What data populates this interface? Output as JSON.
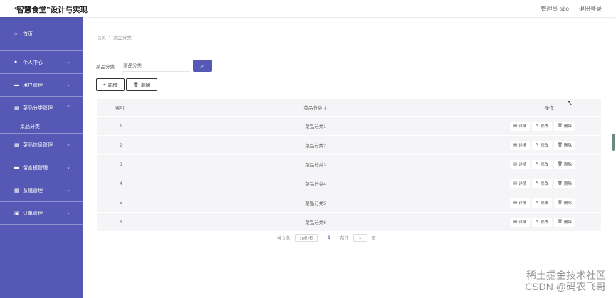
{
  "header": {
    "app_title": "“智慧食堂”设计与实现",
    "user_label": "管理员 abo",
    "logout_label": "退出登录"
  },
  "sidebar": {
    "items": [
      {
        "label": "首页",
        "icon": "home-icon",
        "glyph": "⌂"
      },
      {
        "label": "个人中心",
        "icon": "user-icon",
        "glyph": "●"
      },
      {
        "label": "用户管理",
        "icon": "folder-icon",
        "glyph": "▬"
      },
      {
        "label": "菜品分类管理",
        "icon": "grid-icon",
        "glyph": "▦"
      },
      {
        "label": "菜品信息管理",
        "icon": "grid-icon",
        "glyph": "▦"
      },
      {
        "label": "留言板管理",
        "icon": "card-icon",
        "glyph": "▬"
      },
      {
        "label": "系统管理",
        "icon": "grid-icon",
        "glyph": "▦"
      },
      {
        "label": "订单管理",
        "icon": "lock-icon",
        "glyph": "▣"
      }
    ],
    "sub_item": "菜品分类"
  },
  "breadcrumb": [
    "首页",
    "/",
    "菜品分类"
  ],
  "search": {
    "label": "菜品分类",
    "placeholder": "菜品分类",
    "button_icon": "search-icon"
  },
  "toolbar": {
    "add_label": "新增",
    "delete_label": "删除"
  },
  "table": {
    "headers": [
      "索引",
      "菜品分类 ⇕",
      "操作"
    ],
    "rows": [
      {
        "index": "1",
        "category": "菜品分类1"
      },
      {
        "index": "2",
        "category": "菜品分类2"
      },
      {
        "index": "3",
        "category": "菜品分类3"
      },
      {
        "index": "4",
        "category": "菜品分类4"
      },
      {
        "index": "5",
        "category": "菜品分类5"
      },
      {
        "index": "6",
        "category": "菜品分类6"
      }
    ],
    "actions": {
      "detail": "详情",
      "edit": "修改",
      "delete": "删除"
    }
  },
  "pagination": {
    "total": "共 6 条",
    "page_size": "10条/页",
    "prev": "‹",
    "current": "1",
    "next": "›",
    "goto_label": "前往",
    "goto_value": "1",
    "page_suffix": "页"
  },
  "watermark": "稀土掘金技术社区\nCSDN @码农飞哥",
  "colors": {
    "accent": "#5558b4",
    "table_bg": "#f5f5f7"
  }
}
